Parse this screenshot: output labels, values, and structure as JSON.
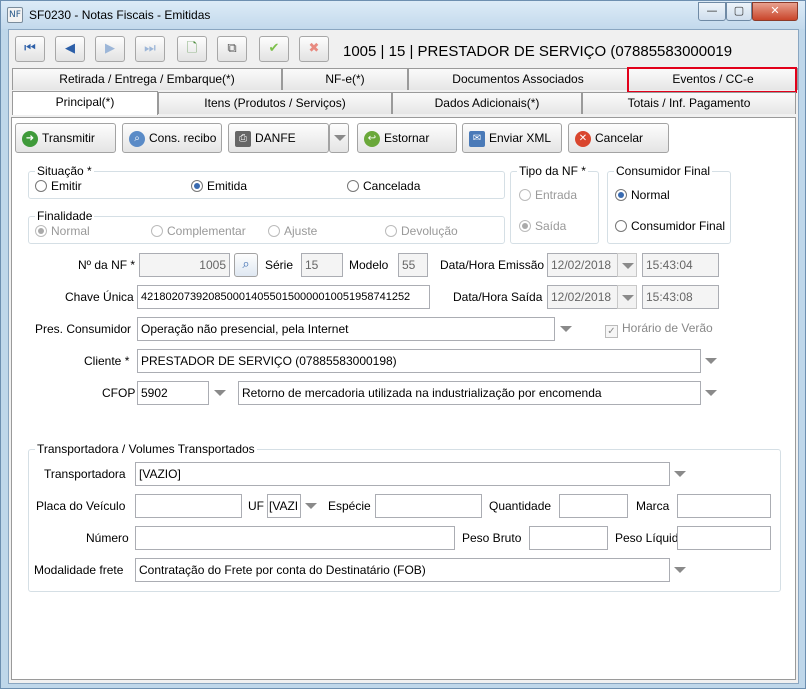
{
  "window": {
    "title": "SF0230 - Notas Fiscais - Emitidas",
    "icon": "app-icon"
  },
  "header": {
    "nf_title": "1005 | 15 | PRESTADOR DE SERVIÇO (07885583000019"
  },
  "tabs_row1": [
    {
      "label": "Retirada / Entrega / Embarque(*)"
    },
    {
      "label": "NF-e(*)"
    },
    {
      "label": "Documentos Associados"
    },
    {
      "label": "Eventos / CC-e"
    }
  ],
  "tabs_row2": [
    {
      "label": "Principal(*)"
    },
    {
      "label": "Itens (Produtos / Serviços)"
    },
    {
      "label": "Dados Adicionais(*)"
    },
    {
      "label": "Totais / Inf. Pagamento"
    }
  ],
  "actions": {
    "transmitir": "Transmitir",
    "cons_recibo": "Cons. recibo",
    "danfe": "DANFE",
    "estornar": "Estornar",
    "enviar_xml": "Enviar XML",
    "cancelar": "Cancelar"
  },
  "situacao": {
    "title": "Situação *",
    "options": [
      "Emitir",
      "Emitida",
      "Cancelada"
    ],
    "selected": "Emitida"
  },
  "tipo_nf": {
    "title": "Tipo da NF *",
    "options": [
      "Entrada",
      "Saída"
    ],
    "selected": "Saída"
  },
  "consumidor_final": {
    "title": "Consumidor Final",
    "options": [
      "Normal",
      "Consumidor Final"
    ],
    "selected": "Normal"
  },
  "finalidade": {
    "title": "Finalidade",
    "options": [
      "Normal",
      "Complementar",
      "Ajuste",
      "Devolução"
    ],
    "selected": "Normal"
  },
  "form": {
    "nf_label": "Nº da NF *",
    "nf_value": "1005",
    "serie_label": "Série",
    "serie_value": "15",
    "modelo_label": "Modelo",
    "modelo_value": "55",
    "emissao_label": "Data/Hora Emissão",
    "emissao_date": "12/02/2018",
    "emissao_time": "15:43:04",
    "chave_label": "Chave Única",
    "chave_value": "42180207392085000140550150000010051958741252",
    "saida_label": "Data/Hora Saída",
    "saida_date": "12/02/2018",
    "saida_time": "15:43:08",
    "pres_label": "Pres. Consumidor",
    "pres_value": "Operação não presencial, pela Internet",
    "horario_verao": "Horário de Verão",
    "cliente_label": "Cliente *",
    "cliente_value": "PRESTADOR DE SERVIÇO (07885583000198)",
    "cfop_label": "CFOP",
    "cfop_code": "5902",
    "cfop_desc": "Retorno de mercadoria utilizada na industrialização por encomenda"
  },
  "transporte": {
    "title": "Transportadora / Volumes Transportados",
    "transportadora_label": "Transportadora",
    "transportadora_value": "[VAZIO]",
    "placa_label": "Placa do Veículo",
    "uf_label": "UF",
    "uf_value": "[VAZI",
    "especie_label": "Espécie",
    "quantidade_label": "Quantidade",
    "marca_label": "Marca",
    "numero_label": "Número",
    "peso_bruto_label": "Peso Bruto",
    "peso_liquido_label": "Peso Líquido",
    "modalidade_label": "Modalidade frete",
    "modalidade_value": "Contratação do Frete por conta do Destinatário (FOB)"
  },
  "colors": {
    "highlight": "#e2001a",
    "accent": "#3a6bb0"
  }
}
